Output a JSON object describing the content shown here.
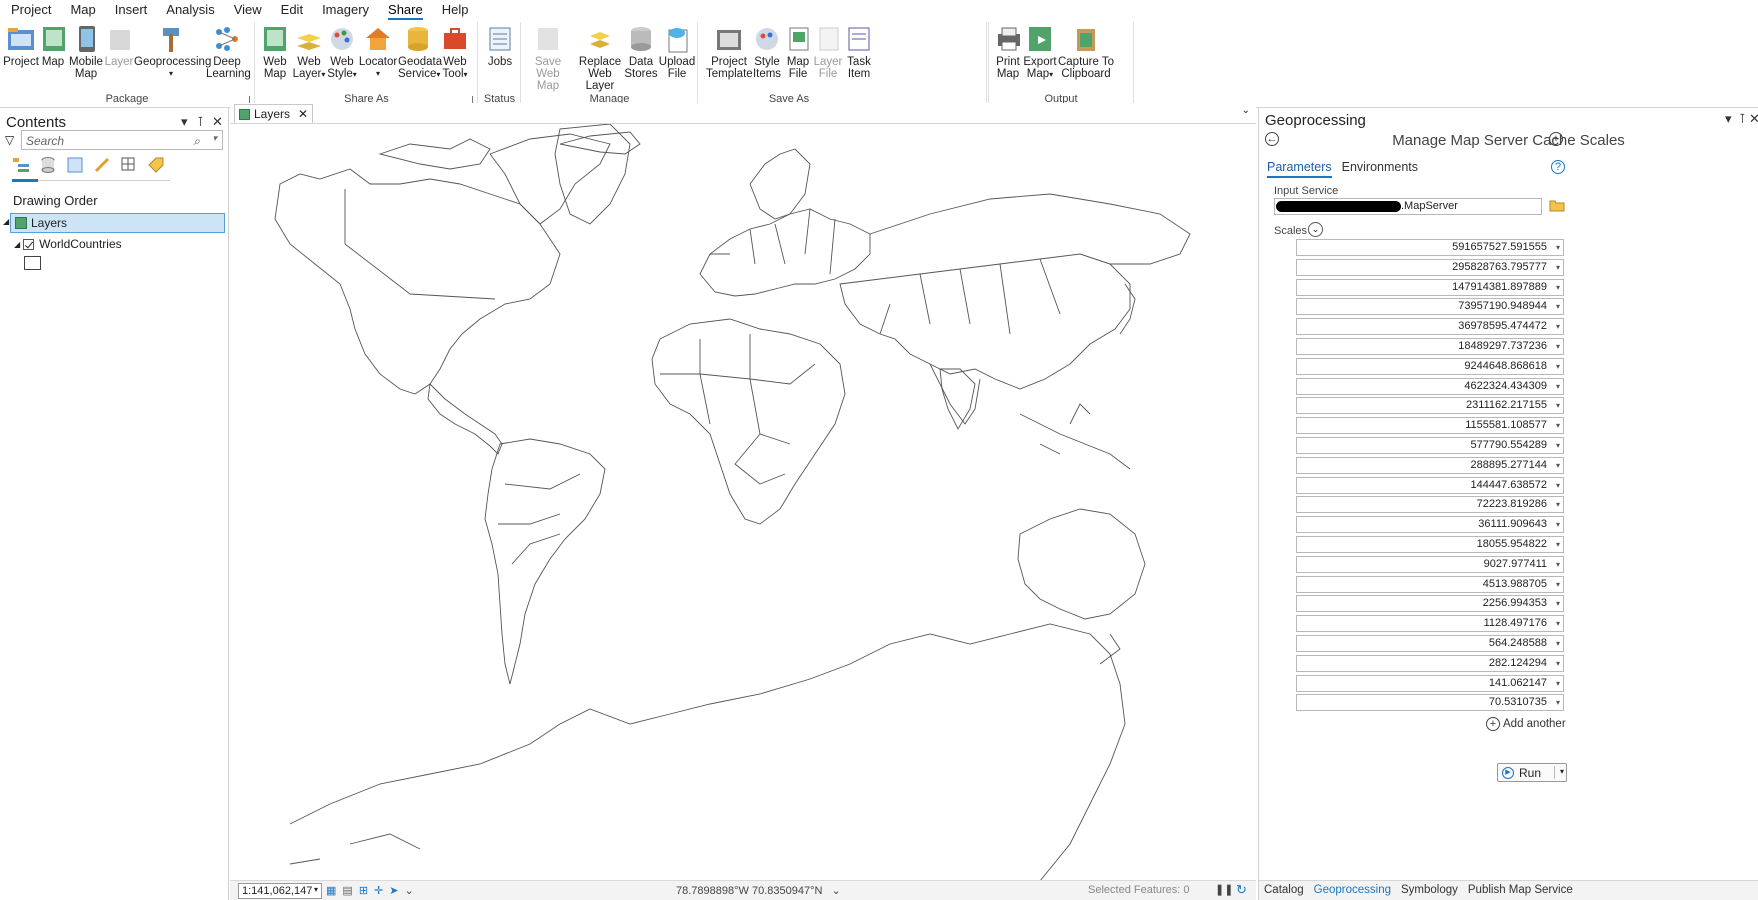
{
  "menu": {
    "tabs": [
      "Project",
      "Map",
      "Insert",
      "Analysis",
      "View",
      "Edit",
      "Imagery",
      "Share",
      "Help"
    ],
    "active_tab": "Share"
  },
  "ribbon": {
    "groups": {
      "package": "Package",
      "share_as": "Share As",
      "status": "Status",
      "manage": "Manage",
      "save_as": "Save As",
      "output": "Output"
    },
    "buttons": {
      "project": [
        "Project",
        ""
      ],
      "map": [
        "Map",
        ""
      ],
      "mobile_map": [
        "Mobile",
        "Map"
      ],
      "layer": [
        "Layer",
        ""
      ],
      "geoprocessing": [
        "Geoprocessing",
        ""
      ],
      "deep_learning": [
        "Deep",
        "Learning"
      ],
      "web_map": [
        "Web",
        "Map"
      ],
      "web_layer": [
        "Web",
        "Layer"
      ],
      "web_style": [
        "Web",
        "Style"
      ],
      "locator": [
        "Locator",
        ""
      ],
      "geodata_service": [
        "Geodata",
        "Service"
      ],
      "web_tool": [
        "Web",
        "Tool"
      ],
      "jobs": [
        "Jobs",
        ""
      ],
      "save_web_map": [
        "Save Web",
        "Map"
      ],
      "replace_web_layer": [
        "Replace",
        "Web Layer"
      ],
      "data_stores": [
        "Data",
        "Stores"
      ],
      "upload_file": [
        "Upload",
        "File"
      ],
      "project_template": [
        "Project",
        "Template"
      ],
      "style_items": [
        "Style",
        "Items"
      ],
      "map_file": [
        "Map",
        "File"
      ],
      "layer_file": [
        "Layer",
        "File"
      ],
      "task_item": [
        "Task",
        "Item"
      ],
      "print_map": [
        "Print",
        "Map"
      ],
      "export_map": [
        "Export",
        "Map"
      ],
      "capture_clipboard": [
        "Capture To",
        "Clipboard"
      ]
    }
  },
  "contents": {
    "title": "Contents",
    "search_placeholder": "Search",
    "drawing_order": "Drawing Order",
    "layers_label": "Layers",
    "layer_name": "WorldCountries"
  },
  "map_view": {
    "tab_label": "Layers",
    "scale": "1:141,062,147",
    "coordinates": "78.7898898°W 70.8350947°N",
    "selected_features": "Selected Features: 0"
  },
  "geoprocessing": {
    "title": "Geoprocessing",
    "tool_name": "Manage Map Server Cache Scales",
    "tabs": [
      "Parameters",
      "Environments"
    ],
    "input_service_label": "Input Service",
    "input_service_value": ".MapServer",
    "scales_label": "Scales",
    "scales": [
      "591657527.591555",
      "295828763.795777",
      "147914381.897889",
      "73957190.948944",
      "36978595.474472",
      "18489297.737236",
      "9244648.868618",
      "4622324.434309",
      "2311162.217155",
      "1155581.108577",
      "577790.554289",
      "288895.277144",
      "144447.638572",
      "72223.819286",
      "36111.909643",
      "18055.954822",
      "9027.977411",
      "4513.988705",
      "2256.994353",
      "1128.497176",
      "564.248588",
      "282.124294",
      "141.062147",
      "70.5310735"
    ],
    "add_another": "Add another",
    "run_label": "Run"
  },
  "bottom_tabs": [
    "Catalog",
    "Geoprocessing",
    "Symbology",
    "Publish Map Service"
  ],
  "bottom_active": "Geoprocessing"
}
